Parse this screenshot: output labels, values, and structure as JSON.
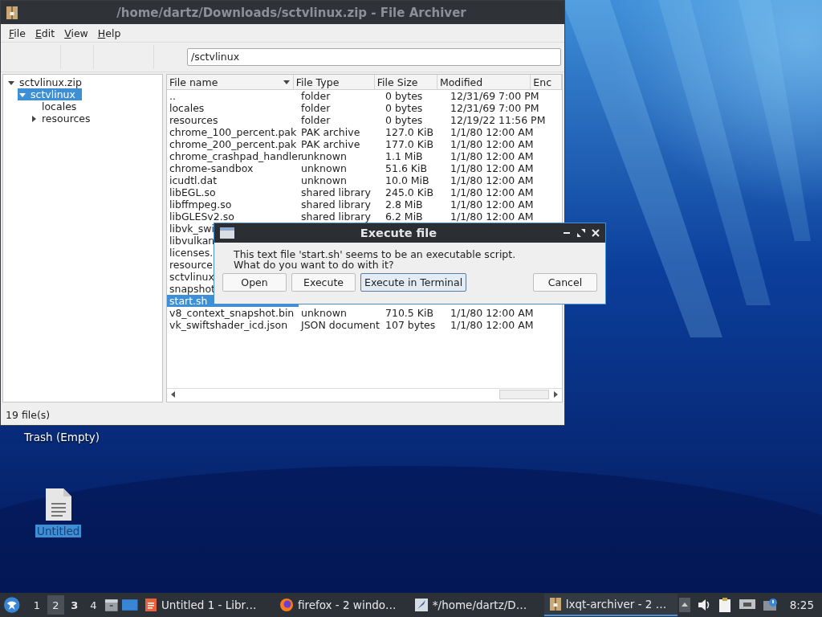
{
  "window": {
    "title": "/home/dartz/Downloads/sctvlinux.zip - File Archiver"
  },
  "menu": [
    "File",
    "Edit",
    "View",
    "Help"
  ],
  "toolbar": {
    "path": "/sctvlinux"
  },
  "tree": [
    {
      "label": "sctvlinux.zip",
      "expanded": true,
      "selected": false,
      "children": [
        {
          "label": "sctvlinux",
          "expanded": true,
          "selected": true,
          "children": [
            {
              "label": "locales",
              "selected": false
            },
            {
              "label": "resources",
              "expanded": false,
              "selected": false
            }
          ]
        }
      ]
    }
  ],
  "table": {
    "columns": [
      {
        "label": "File name",
        "sorted": true
      },
      {
        "label": "File Type",
        "sorted": false
      },
      {
        "label": "File Size",
        "sorted": false
      },
      {
        "label": "Modified",
        "sorted": false
      },
      {
        "label": "Enc",
        "sorted": false
      }
    ],
    "rows": [
      {
        "cells": [
          "..",
          "folder",
          "0 bytes",
          "12/31/69 7:00 PM"
        ],
        "selected": false
      },
      {
        "cells": [
          "locales",
          "folder",
          "0 bytes",
          "12/31/69 7:00 PM"
        ],
        "selected": false
      },
      {
        "cells": [
          "resources",
          "folder",
          "0 bytes",
          "12/19/22 11:56 PM"
        ],
        "selected": false
      },
      {
        "cells": [
          "chrome_100_percent.pak",
          "PAK archive",
          "127.0 KiB",
          "1/1/80 12:00 AM"
        ],
        "selected": false
      },
      {
        "cells": [
          "chrome_200_percent.pak",
          "PAK archive",
          "177.0 KiB",
          "1/1/80 12:00 AM"
        ],
        "selected": false
      },
      {
        "cells": [
          "chrome_crashpad_handler",
          "unknown",
          "1.1 MiB",
          "1/1/80 12:00 AM"
        ],
        "selected": false
      },
      {
        "cells": [
          "chrome-sandbox",
          "unknown",
          "51.6 KiB",
          "1/1/80 12:00 AM"
        ],
        "selected": false
      },
      {
        "cells": [
          "icudtl.dat",
          "unknown",
          "10.0 MiB",
          "1/1/80 12:00 AM"
        ],
        "selected": false
      },
      {
        "cells": [
          "libEGL.so",
          "shared library",
          "245.0 KiB",
          "1/1/80 12:00 AM"
        ],
        "selected": false
      },
      {
        "cells": [
          "libffmpeg.so",
          "shared library",
          "2.8 MiB",
          "1/1/80 12:00 AM"
        ],
        "selected": false
      },
      {
        "cells": [
          "libGLESv2.so",
          "shared library",
          "6.2 MiB",
          "1/1/80 12:00 AM"
        ],
        "selected": false
      },
      {
        "cells": [
          "libvk_swi"
        ],
        "selected": false
      },
      {
        "cells": [
          "libvulkan"
        ],
        "selected": false
      },
      {
        "cells": [
          "licenses."
        ],
        "selected": false
      },
      {
        "cells": [
          "resource"
        ],
        "selected": false
      },
      {
        "cells": [
          "sctvlinux"
        ],
        "selected": false
      },
      {
        "cells": [
          "snapshot"
        ],
        "selected": false
      },
      {
        "cells": [
          "start.sh"
        ],
        "selected": true
      },
      {
        "cells": [
          "v8_context_snapshot.bin",
          "unknown",
          "710.5 KiB",
          "1/1/80 12:00 AM"
        ],
        "selected": false
      },
      {
        "cells": [
          "vk_swiftshader_icd.json",
          "JSON document",
          "107 bytes",
          "1/1/80 12:00 AM"
        ],
        "selected": false
      }
    ]
  },
  "status_bar": "19 file(s)",
  "dialog": {
    "title": "Execute file",
    "message": "This text file 'start.sh' seems to be an executable script.\nWhat do you want to do with it?",
    "buttons": [
      {
        "label": "Open",
        "focused": false
      },
      {
        "label": "Execute",
        "focused": false
      },
      {
        "label": "Execute in Terminal",
        "focused": true
      },
      {
        "label": "Cancel",
        "focused": false
      }
    ]
  },
  "desktop_icons": [
    {
      "label": "Trash (Empty)",
      "selected": false
    },
    {
      "label": "Untitled",
      "selected": true
    }
  ],
  "taskbar": {
    "desktops": [
      {
        "label": "1",
        "selected": false,
        "occupied": false
      },
      {
        "label": "2",
        "selected": true,
        "occupied": false
      },
      {
        "label": "3",
        "selected": false,
        "occupied": true
      },
      {
        "label": "4",
        "selected": false,
        "occupied": false
      }
    ],
    "tasks": [
      {
        "label": "Untitled 1 - Libr…",
        "kind": "document",
        "active": false
      },
      {
        "label": "firefox - 2 windo…",
        "kind": "browser",
        "active": false
      },
      {
        "label": "*/home/dartz/D…",
        "kind": "editor",
        "active": false
      },
      {
        "label": "lxqt-archiver - 2 …",
        "kind": "archive",
        "active": true
      }
    ],
    "clock": "8:25"
  }
}
